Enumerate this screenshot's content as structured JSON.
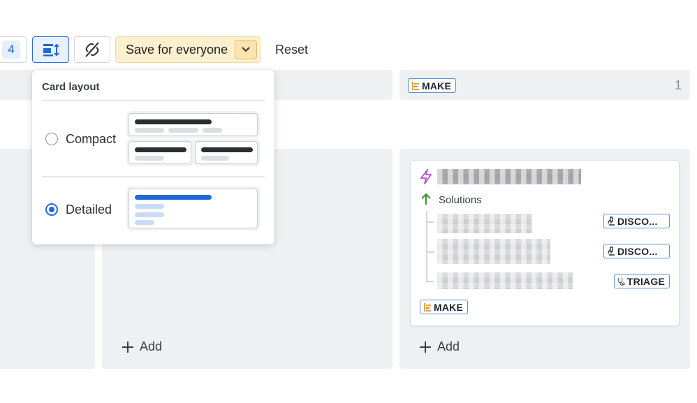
{
  "toolbar": {
    "count_badge": "4",
    "save_label": "Save for everyone",
    "reset_label": "Reset"
  },
  "popover": {
    "title": "Card layout",
    "options": [
      {
        "label": "Compact",
        "selected": false
      },
      {
        "label": "Detailed",
        "selected": true
      }
    ]
  },
  "columns": [
    {
      "header_tag": "MAKE",
      "count": "1"
    }
  ],
  "card": {
    "section_label": "Solutions",
    "child_tags": [
      "DISCO...",
      "DISCO...",
      "TRIAGE"
    ],
    "footer_tag": "MAKE"
  },
  "add_label": "Add",
  "colors": {
    "accent_blue": "#1f6ad8",
    "save_bg": "#fdf0cf",
    "column_bg": "#eef0f2",
    "lightning": "#b04fd9",
    "arrow_green": "#3f8f2c"
  }
}
